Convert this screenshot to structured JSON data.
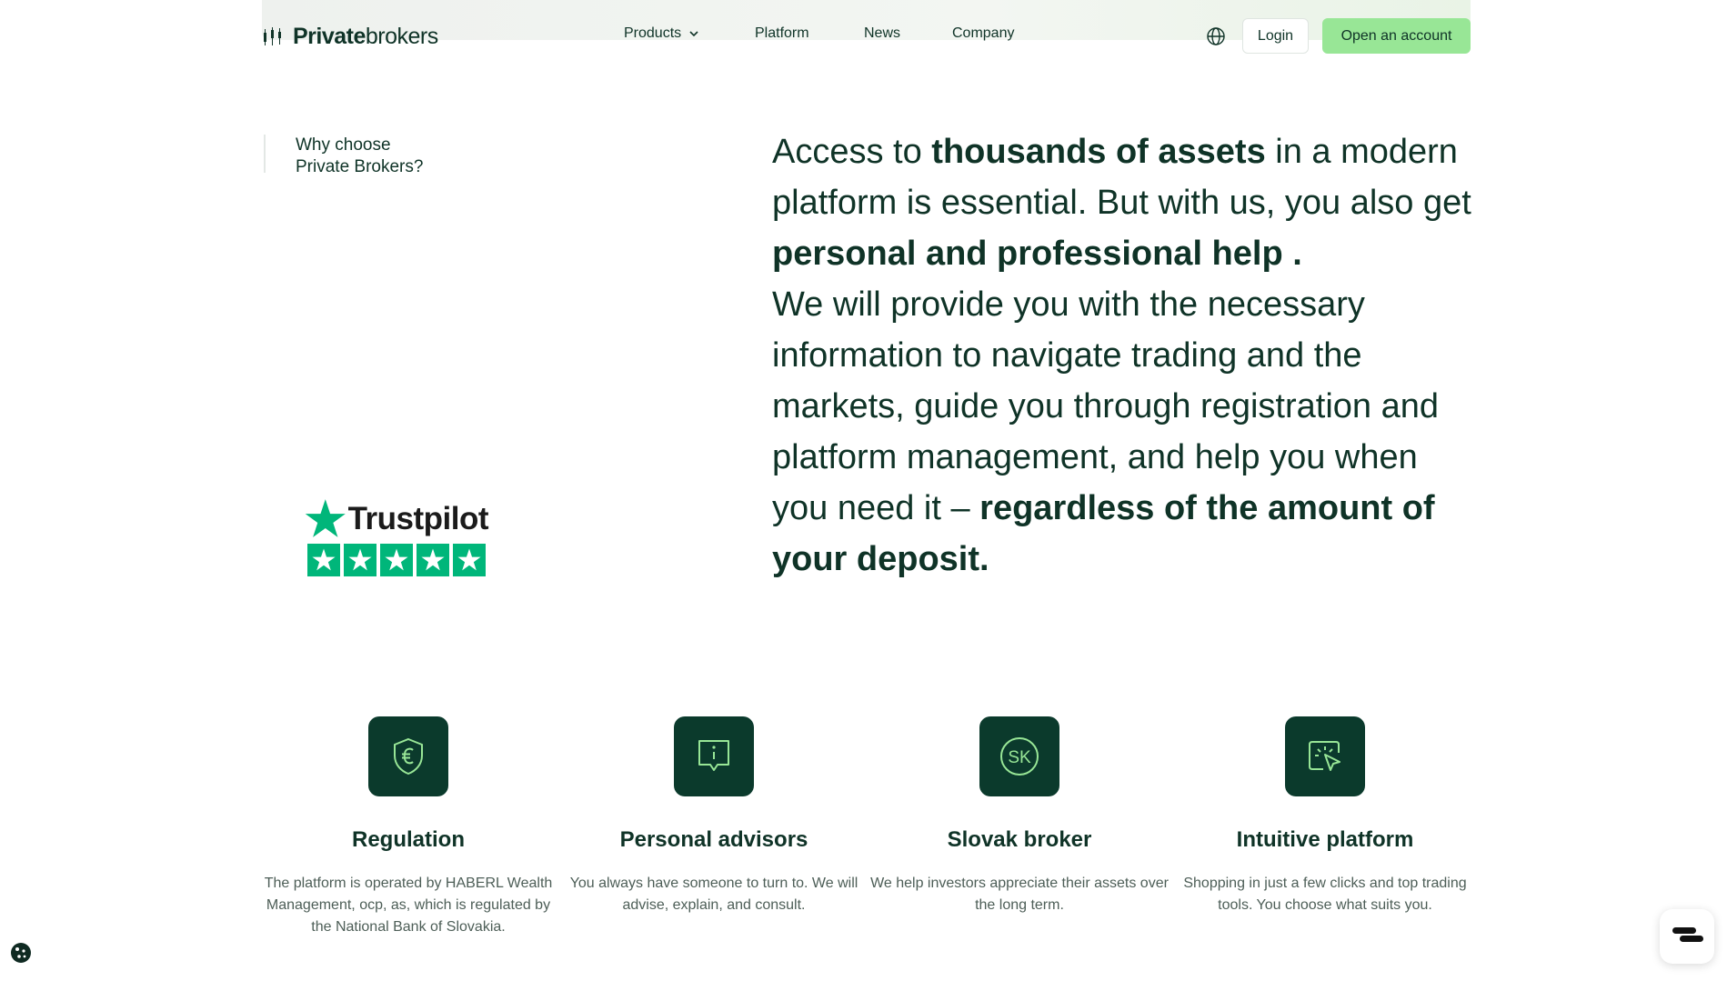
{
  "header": {
    "logo_bold": "Private",
    "logo_regular": "brokers",
    "nav": [
      {
        "label": "Products"
      },
      {
        "label": "Platform"
      },
      {
        "label": "News"
      },
      {
        "label": "Company"
      }
    ],
    "login_label": "Login",
    "open_account_label": "Open an account"
  },
  "why": {
    "line1": "Why choose",
    "line2": "Private Brokers?"
  },
  "trustpilot": {
    "name": "Trustpilot",
    "rating_stars": 5
  },
  "lead": {
    "p1": "Access to ",
    "p2": "thousands of assets",
    "p3": " in a modern platform is essential. But with us, you also get ",
    "p4": "personal and professional help .",
    "p5": "We will provide you with the necessary information to navigate trading and the markets, guide you through registration and platform management, and help you when you need it – ",
    "p6": "regardless of the amount of your deposit."
  },
  "features": [
    {
      "icon": "shield-euro-icon",
      "title": "Regulation",
      "desc": "The platform is operated by HABERL Wealth Management, ocp, as, which is regulated by the National Bank of Slovakia."
    },
    {
      "icon": "info-chat-icon",
      "title": "Personal advisors",
      "desc": "You always have someone to turn to. We will advise, explain, and consult."
    },
    {
      "icon": "sk-circle-icon",
      "title": "Slovak broker",
      "desc": "We help investors appreciate their assets over the long term."
    },
    {
      "icon": "click-cursor-icon",
      "title": "Intuitive platform",
      "desc": "Shopping in just a few clicks and top trading tools. You choose what suits you."
    }
  ],
  "colors": {
    "primary_dark": "#0b3a2c",
    "text": "#0f3327",
    "accent_green": "#98e696",
    "trustpilot_green": "#00b67a",
    "icon_line": "#98e696"
  }
}
